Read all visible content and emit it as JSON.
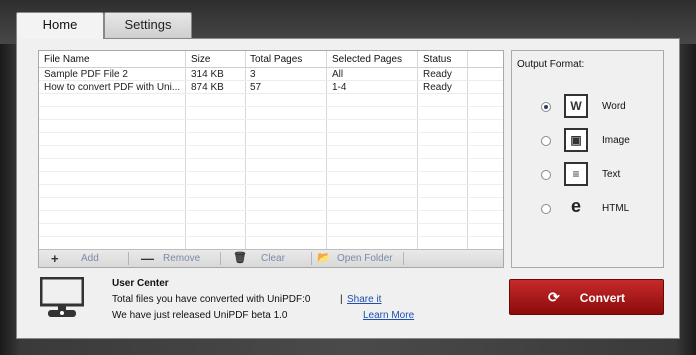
{
  "tabs": {
    "home": "Home",
    "settings": "Settings"
  },
  "table": {
    "headers": [
      "File Name",
      "Size",
      "Total Pages",
      "Selected Pages",
      "Status"
    ],
    "rows": [
      [
        "Sample PDF File 2",
        "314 KB",
        "3",
        "All",
        "Ready"
      ],
      [
        "How to convert PDF with Uni...",
        "874 KB",
        "57",
        "1-4",
        "Ready"
      ]
    ]
  },
  "toolbar": {
    "add": "Add",
    "remove": "Remove",
    "clear": "Clear",
    "open_folder": "Open Folder"
  },
  "output": {
    "title": "Output Format:",
    "options": [
      {
        "label": "Word",
        "icon": "W",
        "selected": true
      },
      {
        "label": "Image",
        "icon": "▣",
        "selected": false
      },
      {
        "label": "Text",
        "icon": "≡",
        "selected": false
      },
      {
        "label": "HTML",
        "icon": "e",
        "selected": false
      }
    ]
  },
  "user_center": {
    "title": "User Center",
    "total_text": "Total files you have converted with UniPDF:0",
    "share_prefix": "|",
    "share_link": "Share it",
    "release_text": "We have just released UniPDF beta 1.0",
    "learn_more": "Learn More"
  },
  "convert": {
    "label": "Convert"
  }
}
